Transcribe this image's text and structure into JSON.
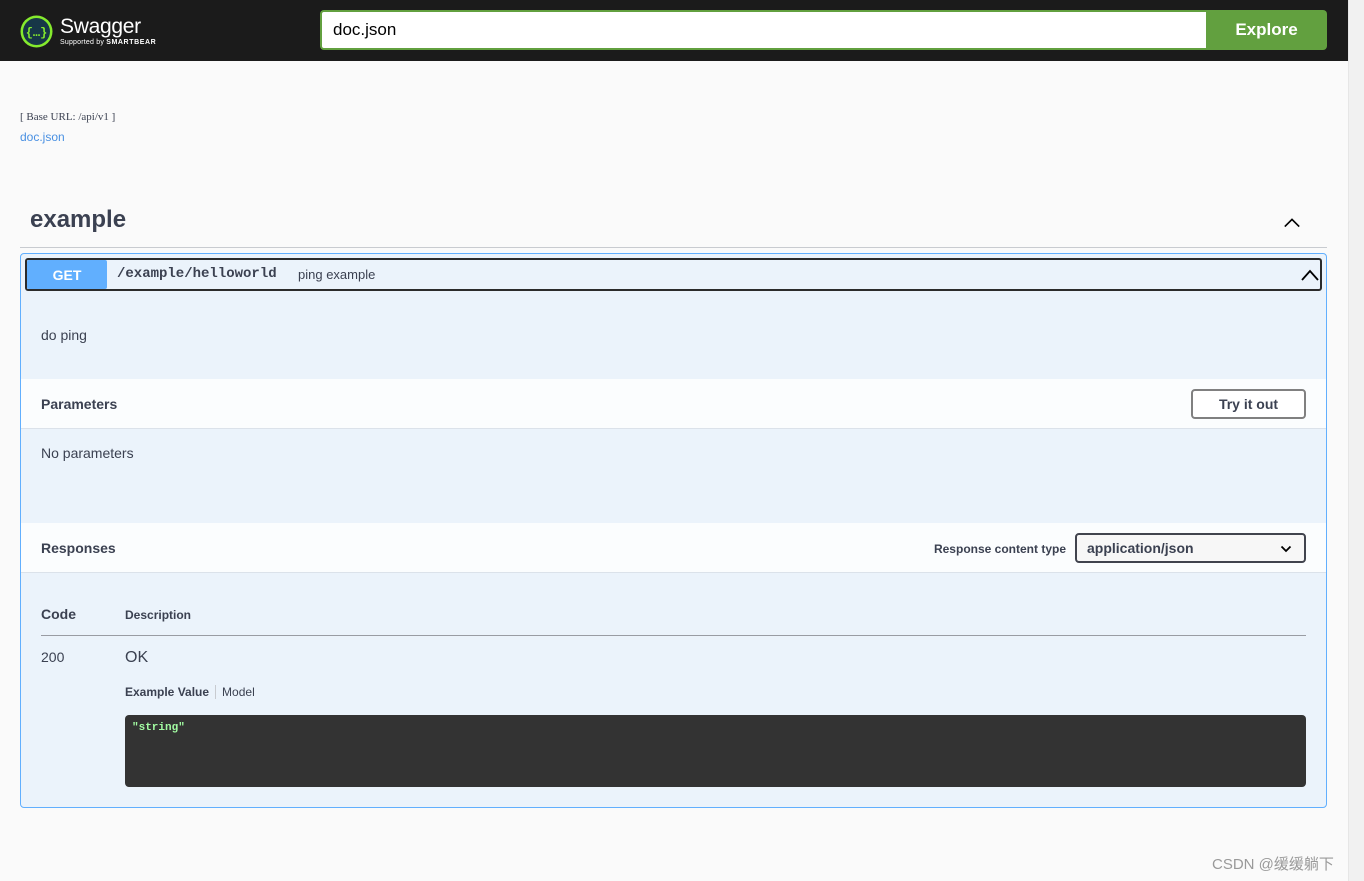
{
  "topbar": {
    "logo_name": "Swagger",
    "logo_sub_prefix": "Supported by",
    "logo_sub_brand": "SMARTBEAR",
    "url_value": "doc.json",
    "explore_label": "Explore"
  },
  "info": {
    "base_url": "[ Base URL: /api/v1 ]",
    "doc_link": "doc.json"
  },
  "tag": {
    "title": "example"
  },
  "operation": {
    "method": "GET",
    "path": "/example/helloworld",
    "summary": "ping example",
    "description": "do ping"
  },
  "parameters": {
    "title": "Parameters",
    "try_label": "Try it out",
    "empty_text": "No parameters"
  },
  "responses": {
    "title": "Responses",
    "content_type_label": "Response content type",
    "content_type_value": "application/json",
    "col_code": "Code",
    "col_description": "Description",
    "rows": [
      {
        "code": "200",
        "description": "OK"
      }
    ],
    "tab_example": "Example Value",
    "tab_model": "Model",
    "example_value": "\"string\""
  },
  "watermark": "CSDN @缓缓躺下",
  "colors": {
    "accent_green": "#62a03f",
    "get_blue": "#61affe",
    "topbar_bg": "#1b1b1b"
  }
}
